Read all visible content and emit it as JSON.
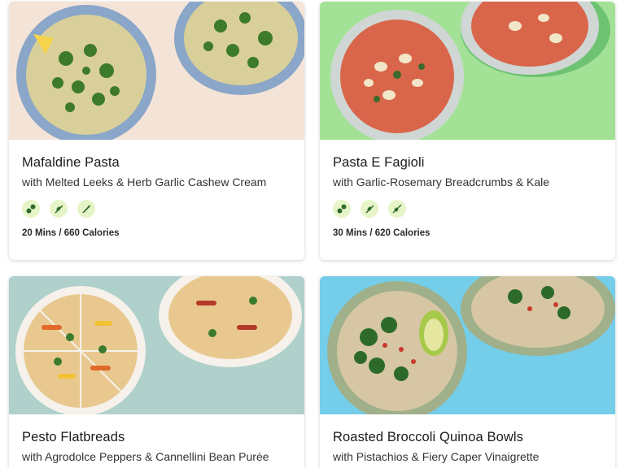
{
  "recipes": [
    {
      "title": "Mafaldine Pasta",
      "subtitle": "with Melted Leeks & Herb Garlic Cashew Cream",
      "meta": "20 Mins / 660 Calories",
      "icons": [
        "nut-free-icon",
        "vegetarian-icon",
        "chef-knife-icon"
      ]
    },
    {
      "title": "Pasta E Fagioli",
      "subtitle": "with Garlic-Rosemary Breadcrumbs & Kale",
      "meta": "30 Mins / 620 Calories",
      "icons": [
        "nut-free-icon",
        "vegetarian-icon",
        "skewer-icon"
      ]
    },
    {
      "title": "Pesto Flatbreads",
      "subtitle": "with Agrodolce Peppers & Cannellini Bean Purée"
    },
    {
      "title": "Roasted Broccoli Quinoa Bowls",
      "subtitle": "with Pistachios & Fiery Caper Vinaigrette"
    }
  ],
  "colors": {
    "icon_bg": "#e6f5c7",
    "icon_fg": "#2f6b2a",
    "photo1_bg": "#f3e3d6",
    "photo2_bg": "#9be08f",
    "photo3_bg": "#8fb8b3",
    "photo4_bg": "#6fc9e8"
  }
}
